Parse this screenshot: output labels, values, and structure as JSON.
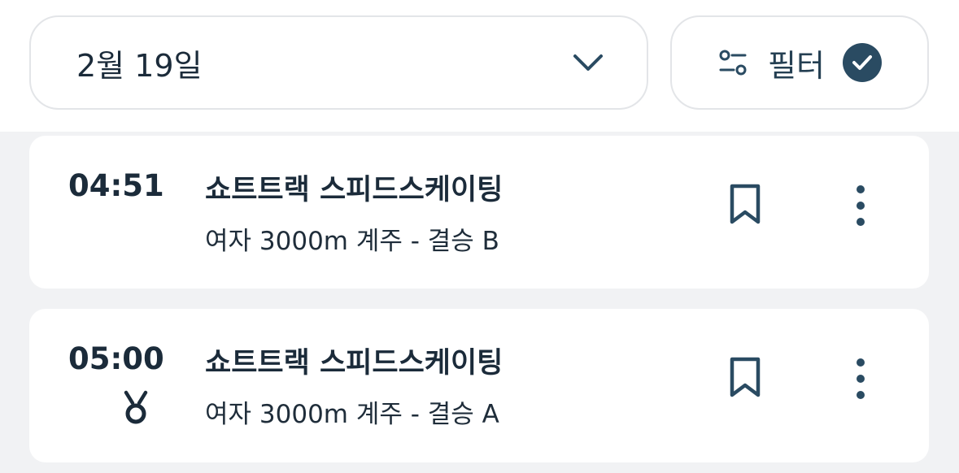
{
  "header": {
    "date_label": "2월 19일",
    "filter_label": "필터"
  },
  "events": [
    {
      "time": "04:51",
      "sport": "쇼트트랙 스피드스케이팅",
      "event": "여자 3000m 계주 - 결승 B",
      "medal": false
    },
    {
      "time": "05:00",
      "sport": "쇼트트랙 스피드스케이팅",
      "event": "여자 3000m 계주 - 결승 A",
      "medal": true
    }
  ],
  "colors": {
    "accent": "#2a4b62",
    "text": "#1b2b3a",
    "background": "#f1f2f4",
    "card": "#ffffff",
    "border": "#e3e5e8"
  }
}
